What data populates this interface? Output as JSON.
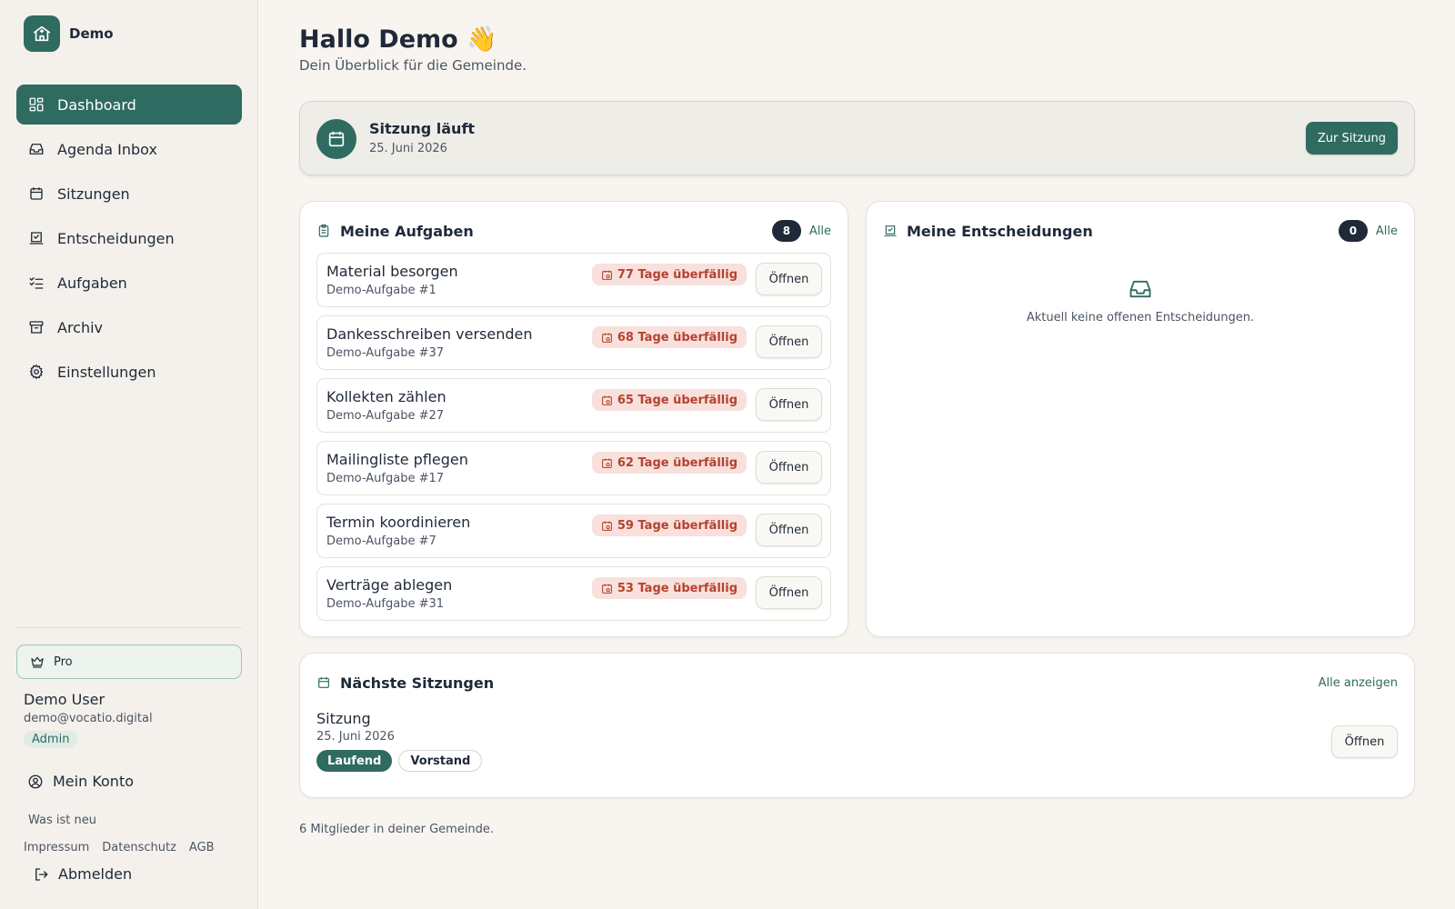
{
  "brand": {
    "name": "Demo"
  },
  "nav": {
    "items": [
      {
        "label": "Dashboard",
        "icon": "dashboard-icon",
        "active": true
      },
      {
        "label": "Agenda Inbox",
        "icon": "inbox-icon"
      },
      {
        "label": "Sitzungen",
        "icon": "calendar-icon"
      },
      {
        "label": "Entscheidungen",
        "icon": "decision-icon"
      },
      {
        "label": "Aufgaben",
        "icon": "tasks-icon"
      },
      {
        "label": "Archiv",
        "icon": "archive-icon"
      },
      {
        "label": "Einstellungen",
        "icon": "gear-icon"
      }
    ]
  },
  "plan": {
    "label": "Pro"
  },
  "user": {
    "name": "Demo User",
    "email": "demo@vocatio.digital",
    "role": "Admin",
    "account_label": "Mein Konto",
    "whats_new": "Was ist neu",
    "legal": [
      "Impressum",
      "Datenschutz",
      "AGB"
    ],
    "logout_label": "Abmelden"
  },
  "header": {
    "title": "Hallo Demo 👋",
    "subtitle": "Dein Überblick für die Gemeinde."
  },
  "banner": {
    "title": "Sitzung läuft",
    "date": "25. Juni 2026",
    "button": "Zur Sitzung"
  },
  "tasks": {
    "title": "Meine Aufgaben",
    "count": "8",
    "all_label": "Alle",
    "open_label": "Öffnen",
    "items": [
      {
        "title": "Material besorgen",
        "sub": "Demo-Aufgabe #1",
        "overdue": "77 Tage überfällig"
      },
      {
        "title": "Dankesschreiben versenden",
        "sub": "Demo-Aufgabe #37",
        "overdue": "68 Tage überfällig"
      },
      {
        "title": "Kollekten zählen",
        "sub": "Demo-Aufgabe #27",
        "overdue": "65 Tage überfällig"
      },
      {
        "title": "Mailingliste pflegen",
        "sub": "Demo-Aufgabe #17",
        "overdue": "62 Tage überfällig"
      },
      {
        "title": "Termin koordinieren",
        "sub": "Demo-Aufgabe #7",
        "overdue": "59 Tage überfällig"
      },
      {
        "title": "Verträge ablegen",
        "sub": "Demo-Aufgabe #31",
        "overdue": "53 Tage überfällig"
      }
    ]
  },
  "decisions": {
    "title": "Meine Entscheidungen",
    "count": "0",
    "all_label": "Alle",
    "empty_text": "Aktuell keine offenen Entscheidungen."
  },
  "next_sessions": {
    "title": "Nächste Sitzungen",
    "all_label": "Alle anzeigen",
    "open_label": "Öffnen",
    "item": {
      "name": "Sitzung",
      "date": "25. Juni 2026",
      "status": "Laufend",
      "group": "Vorstand"
    }
  },
  "footer": {
    "members": "6 Mitglieder in deiner Gemeinde."
  },
  "colors": {
    "accent": "#2f6b60",
    "background": "#f8f5f0",
    "overdue_bg": "#f8e0dc",
    "overdue_text": "#b4432f",
    "count_pill": "#1f2937"
  }
}
